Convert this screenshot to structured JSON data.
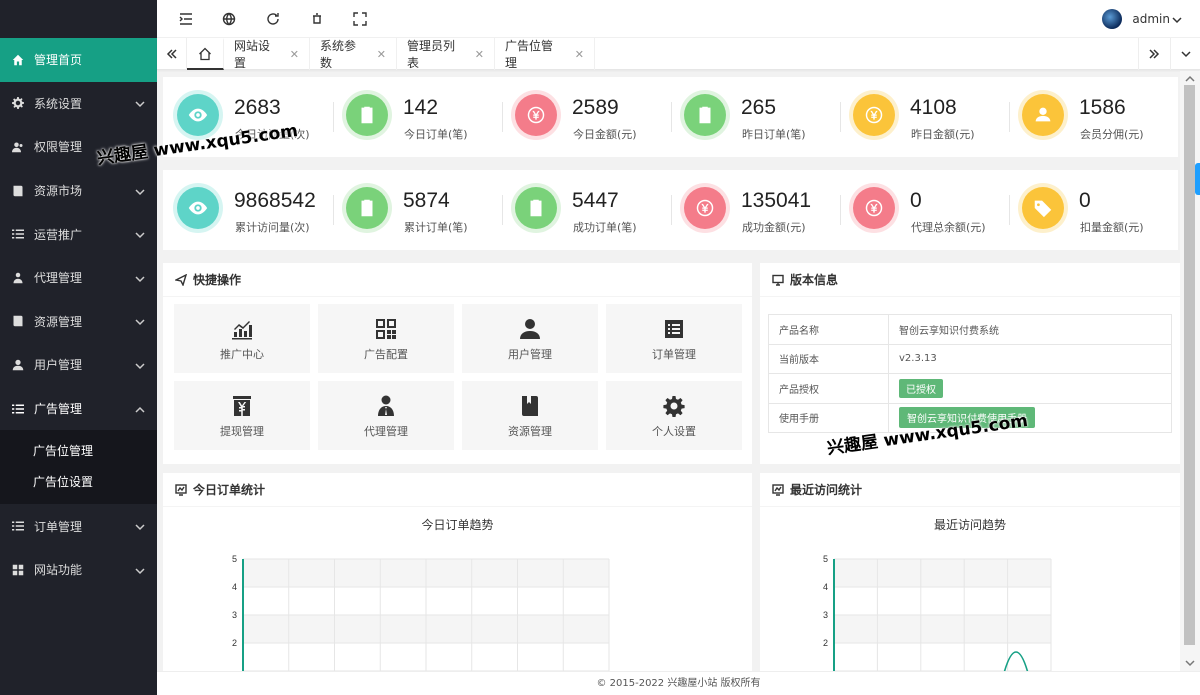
{
  "sidebar": {
    "items": [
      {
        "label": "管理首页",
        "icon": "home-icon",
        "active": true
      },
      {
        "label": "系统设置",
        "icon": "gear-icon"
      },
      {
        "label": "权限管理",
        "icon": "users-icon"
      },
      {
        "label": "资源市场",
        "icon": "book-icon"
      },
      {
        "label": "运营推广",
        "icon": "list-icon"
      },
      {
        "label": "代理管理",
        "icon": "sitemap-icon"
      },
      {
        "label": "资源管理",
        "icon": "book-icon"
      },
      {
        "label": "用户管理",
        "icon": "user-icon"
      },
      {
        "label": "广告管理",
        "icon": "list-icon",
        "expanded": true
      },
      {
        "label": "订单管理",
        "icon": "list-icon"
      },
      {
        "label": "网站功能",
        "icon": "grid-icon"
      }
    ],
    "ad_sub": [
      "广告位管理",
      "广告位设置"
    ]
  },
  "header": {
    "username": "admin"
  },
  "tabs": [
    "网站设置",
    "系统参数",
    "管理员列表",
    "广告位管理"
  ],
  "stats_row1": [
    {
      "value": "2683",
      "label": "今日访问量(次)",
      "color": "#5ed4c8",
      "icon": "eye-icon"
    },
    {
      "value": "142",
      "label": "今日订单(笔)",
      "color": "#7ad27a",
      "icon": "clipboard-icon"
    },
    {
      "value": "2589",
      "label": "今日金额(元)",
      "color": "#f47c8a",
      "icon": "yen-icon"
    },
    {
      "value": "265",
      "label": "昨日订单(笔)",
      "color": "#7ad27a",
      "icon": "clipboard-icon"
    },
    {
      "value": "4108",
      "label": "昨日金额(元)",
      "color": "#fbc43a",
      "icon": "yen-icon"
    },
    {
      "value": "1586",
      "label": "会员分佣(元)",
      "color": "#fbc43a",
      "icon": "user-icon"
    }
  ],
  "stats_row2": [
    {
      "value": "9868542",
      "label": "累计访问量(次)",
      "color": "#5ed4c8",
      "icon": "eye-icon"
    },
    {
      "value": "5874",
      "label": "累计订单(笔)",
      "color": "#7ad27a",
      "icon": "clipboard-icon"
    },
    {
      "value": "5447",
      "label": "成功订单(笔)",
      "color": "#7ad27a",
      "icon": "clipboard-icon"
    },
    {
      "value": "135041",
      "label": "成功金额(元)",
      "color": "#f47c8a",
      "icon": "yen-icon"
    },
    {
      "value": "0",
      "label": "代理总余额(元)",
      "color": "#f47c8a",
      "icon": "yen-icon"
    },
    {
      "value": "0",
      "label": "扣量金额(元)",
      "color": "#fbc43a",
      "icon": "tag-icon"
    }
  ],
  "quick": {
    "title": "快捷操作",
    "items": [
      {
        "label": "推广中心",
        "icon": "chart-icon"
      },
      {
        "label": "广告配置",
        "icon": "qrcode-icon"
      },
      {
        "label": "用户管理",
        "icon": "user-icon"
      },
      {
        "label": "订单管理",
        "icon": "list-icon"
      },
      {
        "label": "提现管理",
        "icon": "yen-box-icon"
      },
      {
        "label": "代理管理",
        "icon": "agent-icon"
      },
      {
        "label": "资源管理",
        "icon": "book-icon"
      },
      {
        "label": "个人设置",
        "icon": "gear-icon"
      }
    ]
  },
  "version": {
    "title": "版本信息",
    "rows": [
      {
        "k": "产品名称",
        "v": "智创云享知识付费系统"
      },
      {
        "k": "当前版本",
        "v": "v2.3.13"
      },
      {
        "k": "产品授权",
        "v": "已授权"
      },
      {
        "k": "使用手册",
        "v": "智创云享知识付费使用手册"
      }
    ]
  },
  "order_chart": {
    "card_title": "今日订单统计",
    "chart_data": {
      "type": "line",
      "title": "今日订单趋势",
      "y_ticks": [
        "5",
        "4",
        "3",
        "2"
      ],
      "ylim": [
        0,
        5
      ],
      "grid": true
    }
  },
  "visit_chart": {
    "card_title": "最近访问统计",
    "chart_data": {
      "type": "line",
      "title": "最近访问趋势",
      "y_ticks": [
        "5",
        "4",
        "3",
        "2"
      ],
      "ylim": [
        0,
        5
      ],
      "grid": true
    }
  },
  "footer": "© 2015-2022 兴趣屋小站 版权所有",
  "watermark": "兴趣屋 www.xqu5.com",
  "colors": {
    "accent": "#16a085",
    "sidebar": "#20222a",
    "green": "#5fb878"
  }
}
